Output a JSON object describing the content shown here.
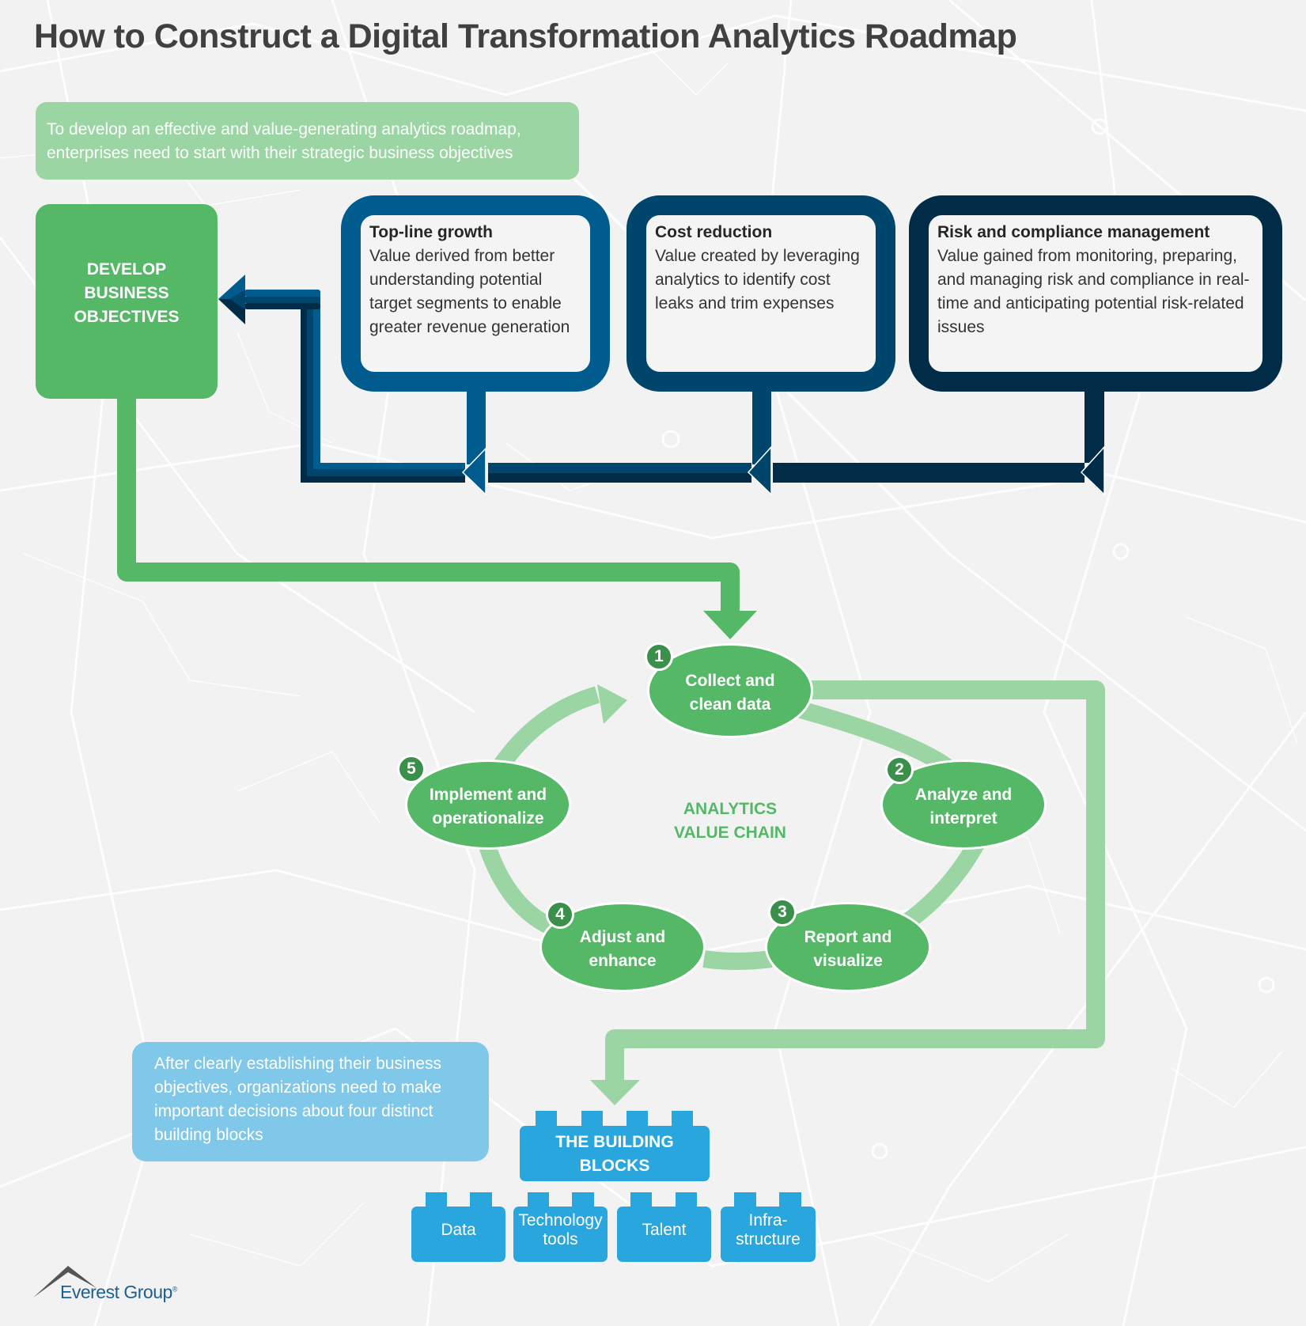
{
  "title": "How to Construct a Digital Transformation Analytics Roadmap",
  "colors": {
    "green": "#55b867",
    "light_green": "#9bd5a3",
    "dark_green_badge": "#3a8f4a",
    "blue_1": "#005b8f",
    "blue_2": "#00456c",
    "blue_3": "#002c47",
    "sky_blue": "#7fc8ea",
    "block_blue": "#29a6de",
    "title_gray": "#404040",
    "background": "#f2f2f2"
  },
  "intro_callout": "To develop an effective and value-generating analytics roadmap, enterprises need to start with their strategic business objectives",
  "develop_box": {
    "lines": [
      "DEVELOP",
      "BUSINESS",
      "OBJECTIVES"
    ]
  },
  "objectives": [
    {
      "title": "Top-line growth",
      "description": "Value derived from better understanding potential target segments to enable greater revenue generation"
    },
    {
      "title": "Cost reduction",
      "description": "Value created by leveraging analytics to identify cost leaks and trim expenses"
    },
    {
      "title": "Risk and compliance management",
      "description": "Value gained from monitoring, preparing, and managing risk and compliance in real-time and anticipating potential risk-related issues"
    }
  ],
  "value_chain": {
    "label_lines": [
      "ANALYTICS",
      "VALUE CHAIN"
    ],
    "steps": [
      {
        "number": "1",
        "lines": [
          "Collect and",
          "clean data"
        ]
      },
      {
        "number": "2",
        "lines": [
          "Analyze and",
          "interpret"
        ]
      },
      {
        "number": "3",
        "lines": [
          "Report and",
          "visualize"
        ]
      },
      {
        "number": "4",
        "lines": [
          "Adjust and",
          "enhance"
        ]
      },
      {
        "number": "5",
        "lines": [
          "Implement and",
          "operationalize"
        ]
      }
    ]
  },
  "building_blocks_callout": "After clearly establishing their business objectives, organizations need to make important decisions about four distinct building blocks",
  "building_blocks": {
    "title_lines": [
      "THE BUILDING",
      "BLOCKS"
    ],
    "items": [
      {
        "lines": [
          "Data"
        ]
      },
      {
        "lines": [
          "Technology",
          "tools"
        ]
      },
      {
        "lines": [
          "Talent"
        ]
      },
      {
        "lines": [
          "Infra-",
          "structure"
        ]
      }
    ]
  },
  "logo": {
    "text": "Everest Group",
    "registered": "®"
  }
}
